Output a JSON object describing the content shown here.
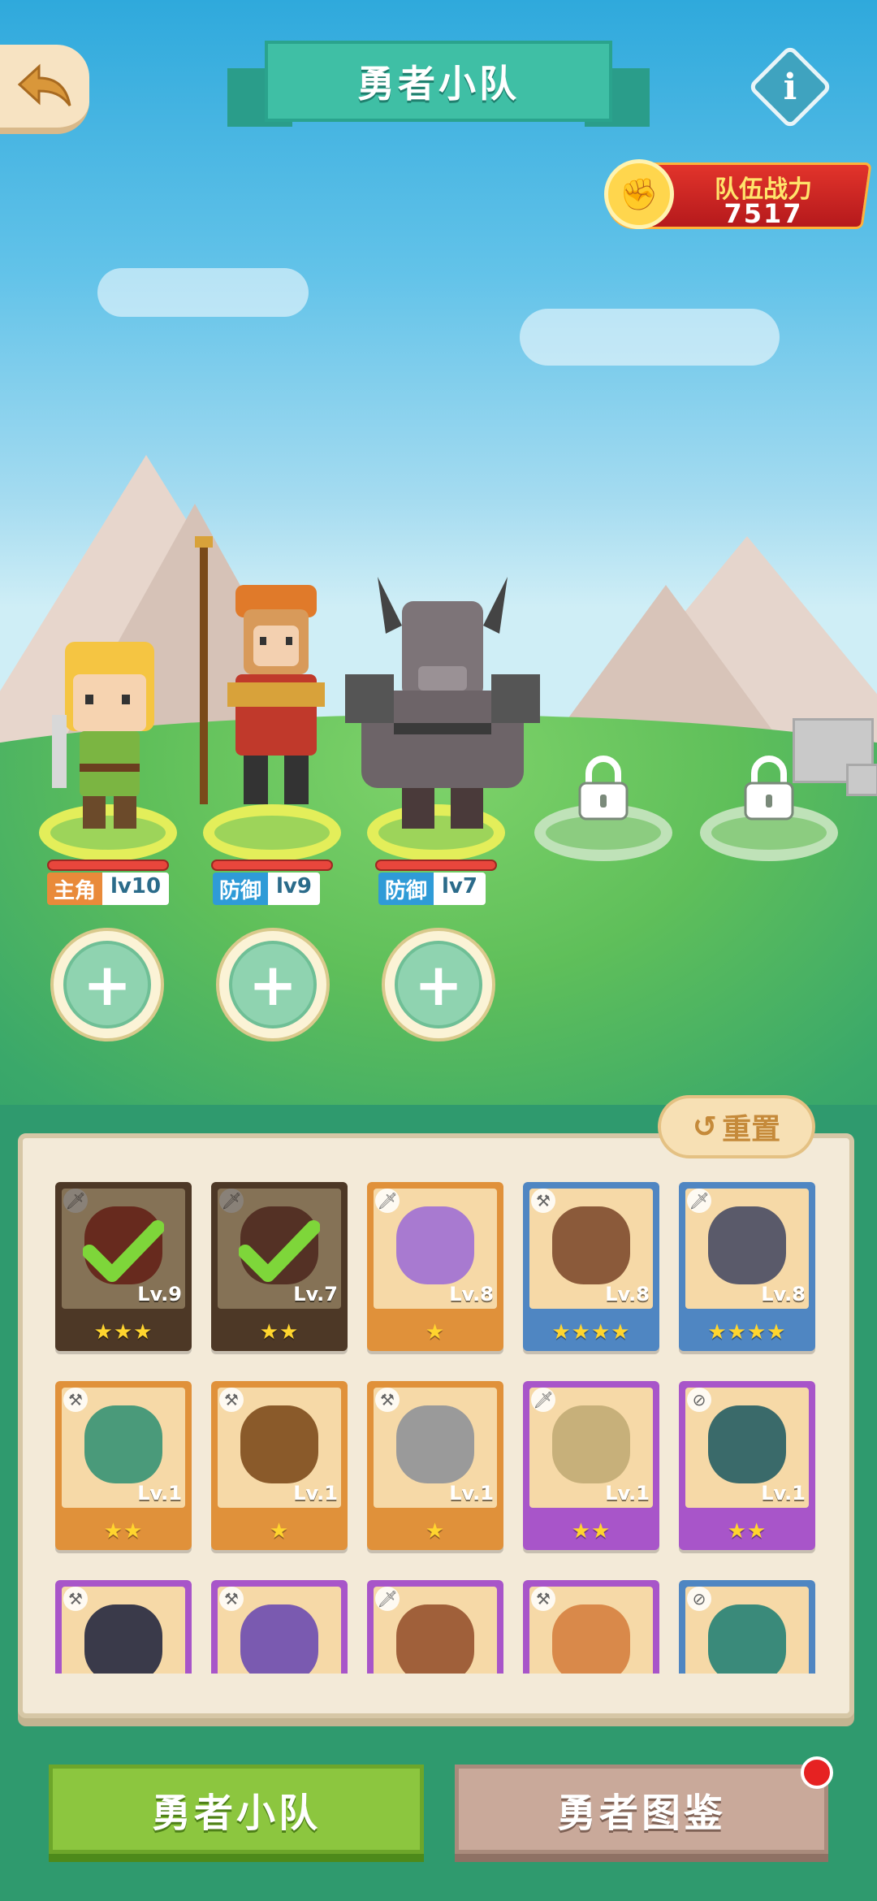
{
  "header": {
    "title": "勇者小队",
    "info_label": "i"
  },
  "power": {
    "label": "队伍战力",
    "value": "7517"
  },
  "team": [
    {
      "role": "主角",
      "role_color": "#e98a3a",
      "level": "lv10"
    },
    {
      "role": "防御",
      "role_color": "#2f9bd7",
      "level": "lv9"
    },
    {
      "role": "防御",
      "role_color": "#2f9bd7",
      "level": "lv7"
    }
  ],
  "add_buttons": [
    "+",
    "+",
    "+"
  ],
  "reset_label": "重置",
  "roster": [
    {
      "level": "Lv.9",
      "stars": "★★★",
      "color": "#7b5a3c",
      "selected": true,
      "type": "sword",
      "face": "#b33a2a"
    },
    {
      "level": "Lv.7",
      "stars": "★★",
      "color": "#7b5a3c",
      "selected": true,
      "type": "sword",
      "face": "#8a4a3a"
    },
    {
      "level": "Lv.8",
      "stars": "★",
      "color": "#e0913a",
      "selected": false,
      "type": "sword",
      "face": "#a87ad0"
    },
    {
      "level": "Lv.8",
      "stars": "★★★★",
      "color": "#4f86c2",
      "selected": false,
      "type": "hammer",
      "face": "#8b5a3a"
    },
    {
      "level": "Lv.8",
      "stars": "★★★★",
      "color": "#4f86c2",
      "selected": false,
      "type": "sword",
      "face": "#5a5a6a"
    },
    {
      "level": "Lv.1",
      "stars": "★★",
      "color": "#e0913a",
      "selected": false,
      "type": "hammer",
      "face": "#4a9a7a"
    },
    {
      "level": "Lv.1",
      "stars": "★",
      "color": "#e0913a",
      "selected": false,
      "type": "hammer",
      "face": "#8a5a2a"
    },
    {
      "level": "Lv.1",
      "stars": "★",
      "color": "#e0913a",
      "selected": false,
      "type": "hammer",
      "face": "#9a9a9a"
    },
    {
      "level": "Lv.1",
      "stars": "★★",
      "color": "#a855c9",
      "selected": false,
      "type": "sword",
      "face": "#c7b07a"
    },
    {
      "level": "Lv.1",
      "stars": "★★",
      "color": "#a855c9",
      "selected": false,
      "type": "ring",
      "face": "#3a6a6a"
    },
    {
      "level": "",
      "stars": "",
      "color": "#a855c9",
      "selected": false,
      "type": "hammer",
      "face": "#3a3a4a"
    },
    {
      "level": "",
      "stars": "",
      "color": "#a855c9",
      "selected": false,
      "type": "hammer",
      "face": "#7a5ab0"
    },
    {
      "level": "",
      "stars": "",
      "color": "#a855c9",
      "selected": false,
      "type": "sword",
      "face": "#a0603a"
    },
    {
      "level": "",
      "stars": "",
      "color": "#a855c9",
      "selected": false,
      "type": "hammer",
      "face": "#d9894a"
    },
    {
      "level": "",
      "stars": "",
      "color": "#4f86c2",
      "selected": false,
      "type": "ring",
      "face": "#3a8a7a"
    }
  ],
  "tabs": {
    "team": "勇者小队",
    "codex": "勇者图鉴"
  }
}
